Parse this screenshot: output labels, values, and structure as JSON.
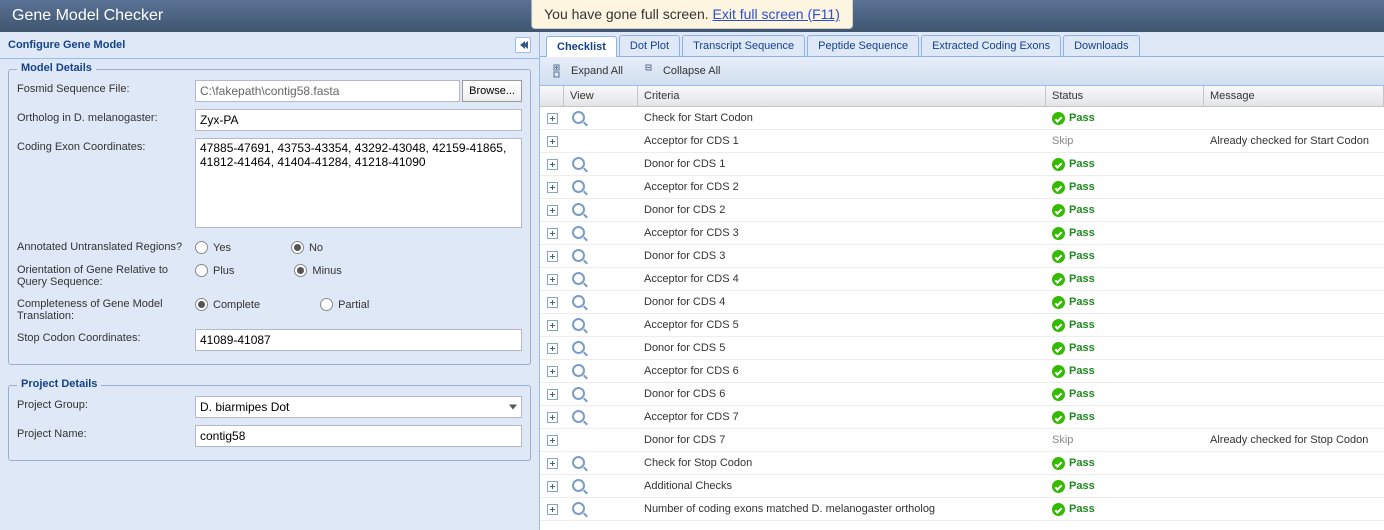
{
  "app_title": "Gene Model Checker",
  "fullscreen": {
    "text": "You have gone full screen.  ",
    "link": "Exit full screen (F11)"
  },
  "left": {
    "header": "Configure Gene Model",
    "model_details": {
      "legend": "Model Details",
      "fosmid_label": "Fosmid Sequence File:",
      "fosmid_value": "C:\\fakepath\\contig58.fasta",
      "browse": "Browse...",
      "ortholog_label": "Ortholog in D. melanogaster:",
      "ortholog_value": "Zyx-PA",
      "exon_label": "Coding Exon Coordinates:",
      "exon_value": "47885-47691, 43753-43354, 43292-43048, 42159-41865, 41812-41464, 41404-41284, 41218-41090",
      "utr_label": "Annotated Untranslated Regions?",
      "utr_yes": "Yes",
      "utr_no": "No",
      "orient_label": "Orientation of Gene Relative to Query Sequence:",
      "orient_plus": "Plus",
      "orient_minus": "Minus",
      "complete_label": "Completeness of Gene Model Translation:",
      "complete_c": "Complete",
      "complete_p": "Partial",
      "stop_label": "Stop Codon Coordinates:",
      "stop_value": "41089-41087"
    },
    "project_details": {
      "legend": "Project Details",
      "group_label": "Project Group:",
      "group_value": "D. biarmipes Dot",
      "name_label": "Project Name:",
      "name_value": "contig58"
    }
  },
  "tabs": [
    "Checklist",
    "Dot Plot",
    "Transcript Sequence",
    "Peptide Sequence",
    "Extracted Coding Exons",
    "Downloads"
  ],
  "toolbar": {
    "expand": "Expand All",
    "collapse": "Collapse All"
  },
  "grid_headers": {
    "view": "View",
    "criteria": "Criteria",
    "status": "Status",
    "message": "Message"
  },
  "status_labels": {
    "pass": "Pass",
    "skip": "Skip"
  },
  "rows": [
    {
      "view": true,
      "criteria": "Check for Start Codon",
      "status": "pass",
      "message": ""
    },
    {
      "view": false,
      "criteria": "Acceptor for CDS 1",
      "status": "skip",
      "message": "Already checked for Start Codon"
    },
    {
      "view": true,
      "criteria": "Donor for CDS 1",
      "status": "pass",
      "message": ""
    },
    {
      "view": true,
      "criteria": "Acceptor for CDS 2",
      "status": "pass",
      "message": ""
    },
    {
      "view": true,
      "criteria": "Donor for CDS 2",
      "status": "pass",
      "message": ""
    },
    {
      "view": true,
      "criteria": "Acceptor for CDS 3",
      "status": "pass",
      "message": ""
    },
    {
      "view": true,
      "criteria": "Donor for CDS 3",
      "status": "pass",
      "message": ""
    },
    {
      "view": true,
      "criteria": "Acceptor for CDS 4",
      "status": "pass",
      "message": ""
    },
    {
      "view": true,
      "criteria": "Donor for CDS 4",
      "status": "pass",
      "message": ""
    },
    {
      "view": true,
      "criteria": "Acceptor for CDS 5",
      "status": "pass",
      "message": ""
    },
    {
      "view": true,
      "criteria": "Donor for CDS 5",
      "status": "pass",
      "message": ""
    },
    {
      "view": true,
      "criteria": "Acceptor for CDS 6",
      "status": "pass",
      "message": ""
    },
    {
      "view": true,
      "criteria": "Donor for CDS 6",
      "status": "pass",
      "message": ""
    },
    {
      "view": true,
      "criteria": "Acceptor for CDS 7",
      "status": "pass",
      "message": ""
    },
    {
      "view": false,
      "criteria": "Donor for CDS 7",
      "status": "skip",
      "message": "Already checked for Stop Codon"
    },
    {
      "view": true,
      "criteria": "Check for Stop Codon",
      "status": "pass",
      "message": ""
    },
    {
      "view": true,
      "criteria": "Additional Checks",
      "status": "pass",
      "message": ""
    },
    {
      "view": true,
      "criteria": "Number of coding exons matched D. melanogaster ortholog",
      "status": "pass",
      "message": ""
    }
  ]
}
